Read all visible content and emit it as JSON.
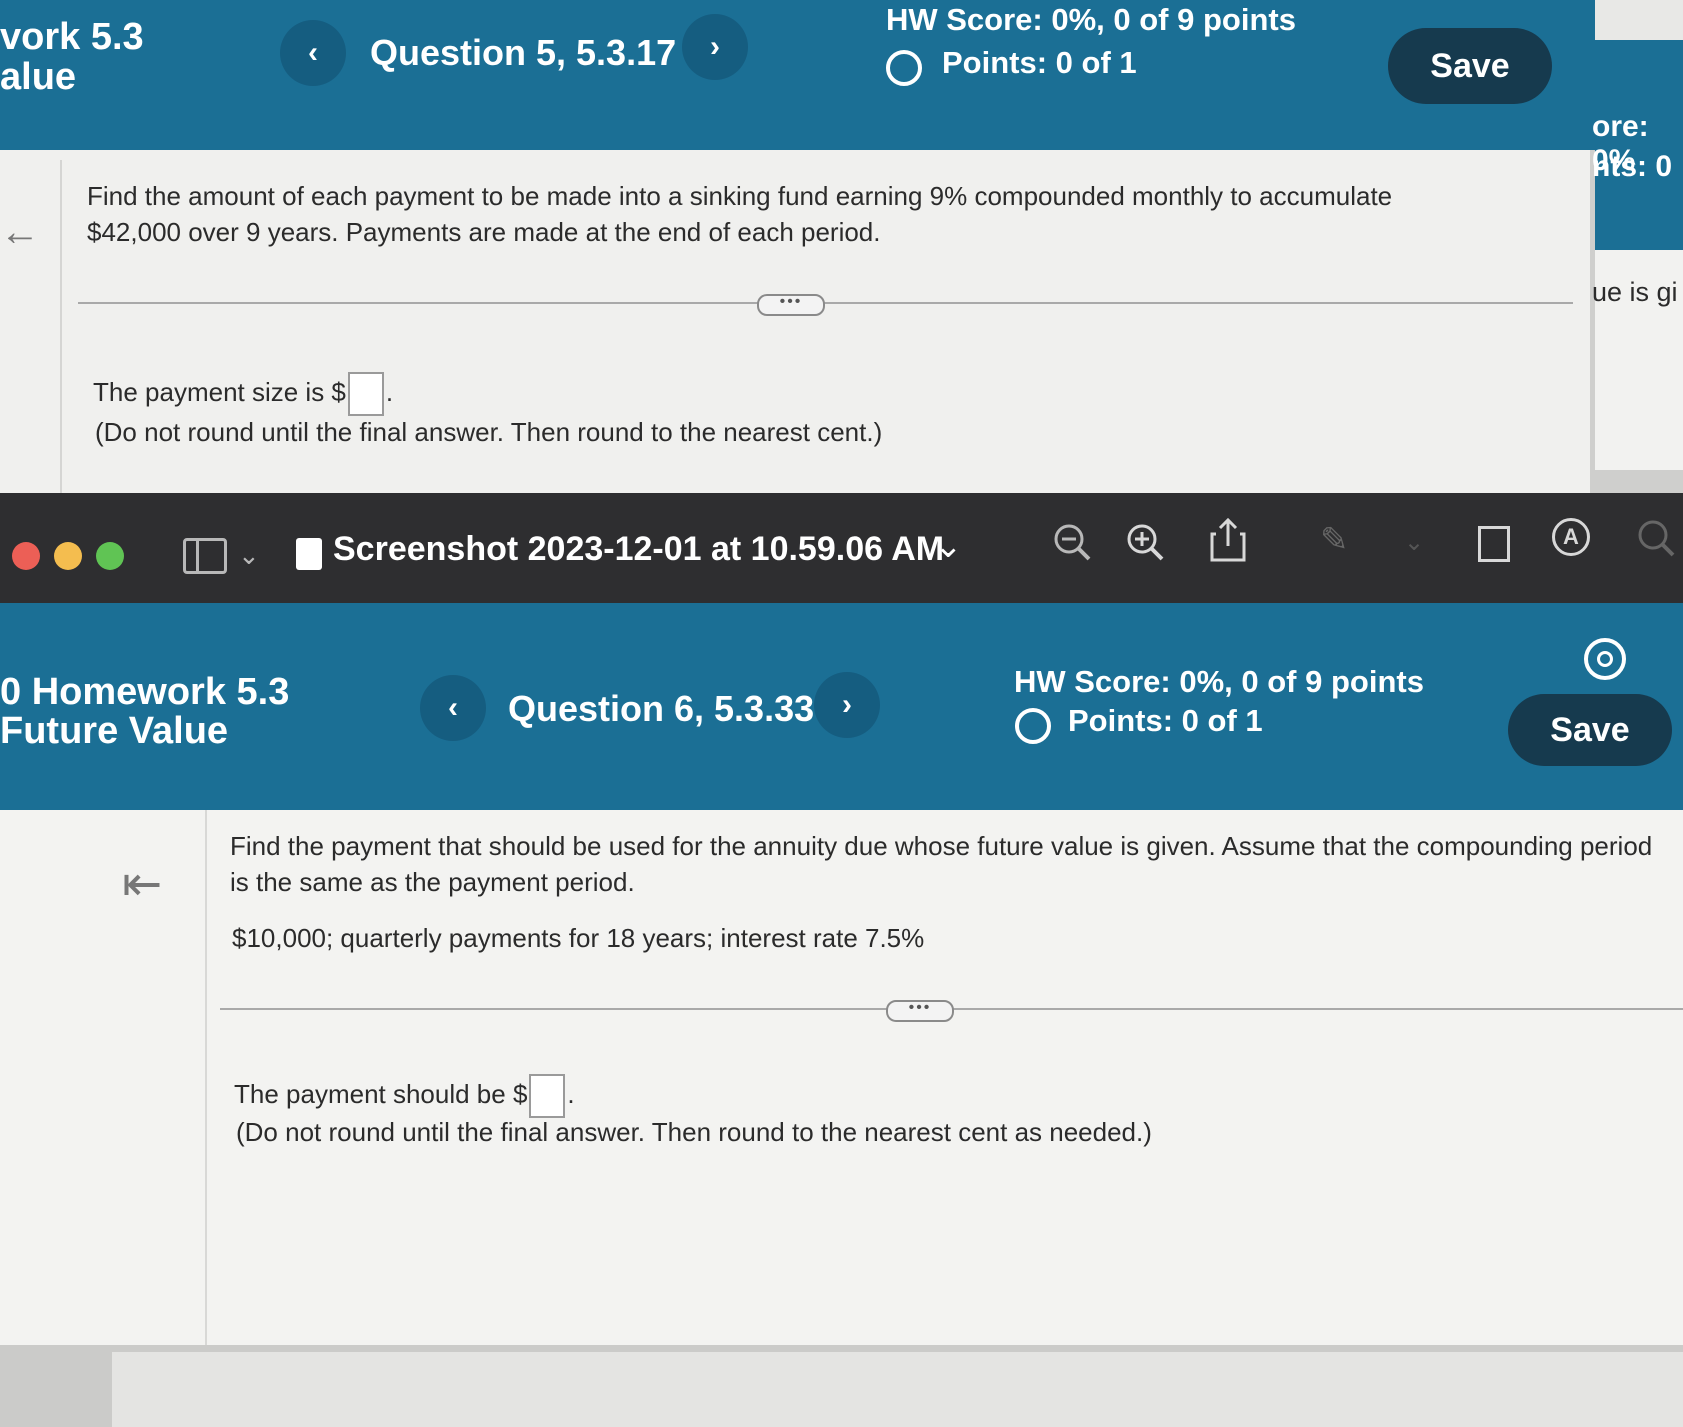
{
  "top_window": {
    "course_line1": "vork 5.3",
    "course_line2": "alue",
    "question_label": "Question 5, 5.3.17",
    "hw_score": "HW Score: 0%, 0 of 9 points",
    "points": "Points: 0 of 1",
    "save_label": "Save",
    "question_text": "Find the amount of each payment to be made into a sinking fund earning 9% compounded monthly to accumulate $42,000 over 9 years. Payments are made at the end of each period.",
    "more_label": "•••",
    "answer_prefix": "The payment size is $",
    "answer_suffix": ".",
    "answer_note": "(Do not round until the final answer. Then round to the nearest cent.)",
    "side_score": "ore: 0%",
    "side_points": "nts: 0",
    "side_text": "ue is gi"
  },
  "viewer": {
    "title": "Screenshot 2023-12-01 at 10.59.06 AM",
    "traffic_lights": {
      "close": "#ec5f56",
      "minimize": "#f4bd4f",
      "maximize": "#60c454"
    }
  },
  "bottom_window": {
    "course_line1": "0 Homework 5.3",
    "course_line2": "Future Value",
    "question_label": "Question 6, 5.3.33",
    "hw_score": "HW Score: 0%, 0 of 9 points",
    "points": "Points: 0 of 1",
    "save_label": "Save",
    "question_text": "Find the payment that should be used for the annuity due whose future value is given. Assume that the compounding period is the same as the payment period.",
    "given": "$10,000; quarterly payments for 18 years; interest rate 7.5%",
    "more_label": "•••",
    "answer_prefix": "The payment should be $",
    "answer_suffix": ".",
    "answer_note": "(Do not round until the final answer. Then round to the nearest cent as needed.)"
  },
  "colors": {
    "header_blue": "#1b6f95",
    "save_dark": "#163a4e",
    "toolbar": "#2e2e30"
  }
}
